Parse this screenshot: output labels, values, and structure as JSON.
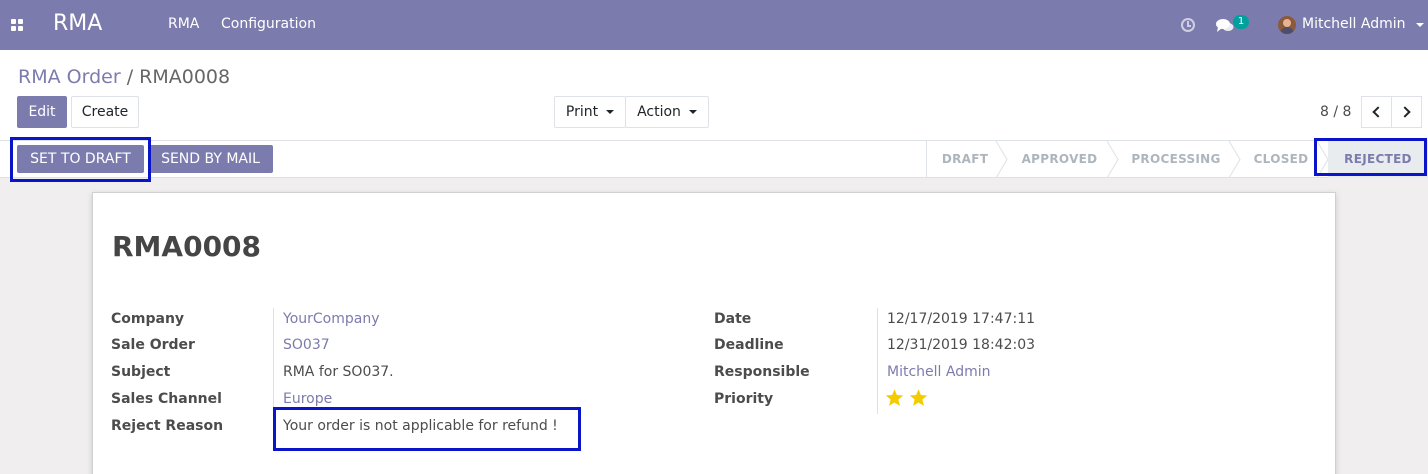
{
  "navbar": {
    "app_name": "RMA",
    "menu": [
      "RMA",
      "Configuration"
    ],
    "chat_count": "1",
    "user_name": "Mitchell Admin",
    "icons": [
      "apps-grid-icon",
      "clock-icon",
      "chat-icon",
      "avatar",
      "caret-down-icon"
    ]
  },
  "breadcrumb": {
    "parent": "RMA Order",
    "separator": "/",
    "current": "RMA0008"
  },
  "actions": {
    "edit": "Edit",
    "create": "Create",
    "print": "Print",
    "action": "Action"
  },
  "pager": {
    "value": "8 / 8"
  },
  "header_buttons": {
    "set_to_draft": "SET TO DRAFT",
    "send_by_mail": "SEND BY MAIL"
  },
  "stages": [
    {
      "label": "DRAFT",
      "active": false
    },
    {
      "label": "APPROVED",
      "active": false
    },
    {
      "label": "PROCESSING",
      "active": false
    },
    {
      "label": "CLOSED",
      "active": false
    },
    {
      "label": "REJECTED",
      "active": true
    }
  ],
  "record": {
    "title": "RMA0008",
    "left_fields": [
      {
        "label": "Company",
        "value": "YourCompany",
        "link": true
      },
      {
        "label": "Sale Order",
        "value": "SO037",
        "link": true
      },
      {
        "label": "Subject",
        "value": "RMA for SO037.",
        "link": false
      },
      {
        "label": "Sales Channel",
        "value": "Europe",
        "link": true
      },
      {
        "label": "Reject Reason",
        "value": "Your order is not applicable for refund !",
        "link": false
      }
    ],
    "right_fields": [
      {
        "label": "Date",
        "value": "12/17/2019 17:47:11",
        "link": false
      },
      {
        "label": "Deadline",
        "value": "12/31/2019 18:42:03",
        "link": false
      },
      {
        "label": "Responsible",
        "value": "Mitchell Admin",
        "link": true
      },
      {
        "label": "Priority"
      }
    ],
    "priority_stars": 2
  },
  "colors": {
    "brand": "#7c7bad",
    "highlight": "#0a14c8",
    "star": "#f3cc00",
    "badge": "#00a09d"
  }
}
